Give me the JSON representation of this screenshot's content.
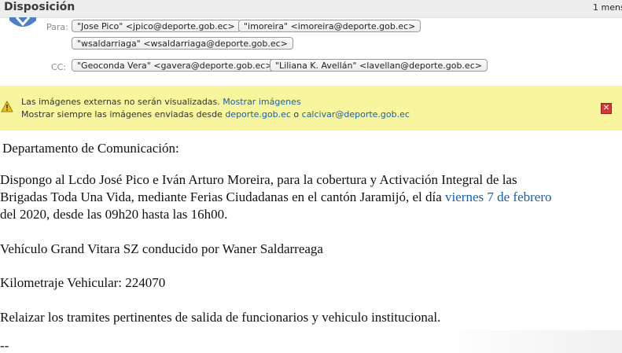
{
  "header": {
    "subject": "Disposición",
    "message_count": "1 mens"
  },
  "recipients": {
    "to_label": "Para:",
    "to": [
      "\"Jose Pico\" <jpico@deporte.gob.ec>",
      "\"imoreira\" <imoreira@deporte.gob.ec>",
      "\"wsaldarriaga\" <wsaldarriaga@deporte.gob.ec>"
    ],
    "cc_label": "CC:",
    "cc": [
      "\"Geoconda Vera\" <gavera@deporte.gob.ec>",
      "\"Liliana K. Avellán\" <lavellan@deporte.gob.ec>"
    ]
  },
  "warning": {
    "line1_text": "Las imágenes externas no serán visualizadas.",
    "show_images_link": "Mostrar imágenes",
    "line2_text": "Mostrar siempre las imágenes enviadas desde",
    "domain_link": "deporte.gob.ec",
    "or_text": "o",
    "sender_link": "calcivar@deporte.gob.ec",
    "icon": "warning-icon",
    "close_icon": "close-icon"
  },
  "email_body": {
    "greeting": "Departamento de Comunicación:",
    "p1_line1": "Dispongo al Lcdo José Pico e Iván Arturo Moreira, para la cobertura y Activación Integral de las",
    "p1_line2_before": "Brigadas Toda Una Vida, mediante Ferias Ciudadanas en el cantón Jaramijó, el día",
    "p1_date_link": "viernes 7 de febrero",
    "p1_line3": "del 2020, desde las 09h20 hasta las 16h00.",
    "vehicle": "Vehículo Grand Vitara SZ conducido por Waner Saldarreaga",
    "mileage": "Kilometraje Vehicular: 224070",
    "instructions": "Relaizar los tramites pertinentes de salida de funcionarios y vehiculo institucional.",
    "signature_sep": "--"
  },
  "colors": {
    "warning_bg": "#f8f59f",
    "link": "#1a5fa8",
    "close_red": "#d23a3a"
  }
}
